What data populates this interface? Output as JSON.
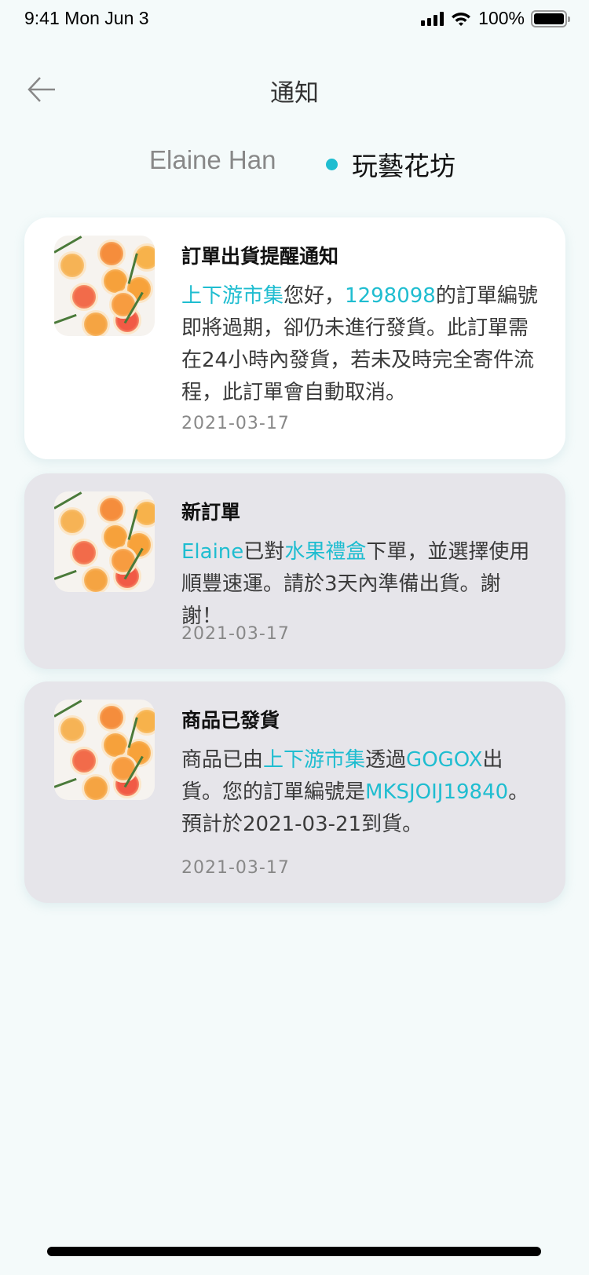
{
  "status_bar": {
    "time": "9:41  Mon Jun 3",
    "battery": "100%"
  },
  "header": {
    "title": "通知",
    "back_icon": "arrow-left-icon"
  },
  "tabs": [
    {
      "label": "Elaine Han",
      "active": false
    },
    {
      "label": "玩藝花坊",
      "active": true
    }
  ],
  "colors": {
    "accent": "#1fbdd0",
    "background": "#f4fafa",
    "unread_card": "#ffffff",
    "read_card": "#e6e5ea"
  },
  "notifications": [
    {
      "title": "訂單出貨提醒通知",
      "segments": [
        {
          "t": "上下游市集",
          "a": true
        },
        {
          "t": "您好，"
        },
        {
          "t": "1298098",
          "a": true
        },
        {
          "t": "的訂單編號即將過期，卻仍未進行發貨。此訂單需在24小時內發貨，若未及時完全寄件流程，此訂單會自動取消。"
        }
      ],
      "date": "2021-03-17",
      "read": false
    },
    {
      "title": "新訂單",
      "segments": [
        {
          "t": "Elaine",
          "a": true
        },
        {
          "t": "已對"
        },
        {
          "t": "水果禮盒",
          "a": true
        },
        {
          "t": "下單，並選擇使用順豐速運。請於3天內準備出貨。謝謝！"
        }
      ],
      "date": "2021-03-17",
      "read": true
    },
    {
      "title": "商品已發貨",
      "segments": [
        {
          "t": "商品已由"
        },
        {
          "t": "上下游市集",
          "a": true
        },
        {
          "t": "透過"
        },
        {
          "t": "GOGOX",
          "a": true
        },
        {
          "t": "出貨。您的訂單編號是"
        },
        {
          "t": "MKSJOIJ19840",
          "a": true
        },
        {
          "t": "。預計於2021-03-21到貨。"
        }
      ],
      "date": "2021-03-17",
      "read": true
    }
  ]
}
